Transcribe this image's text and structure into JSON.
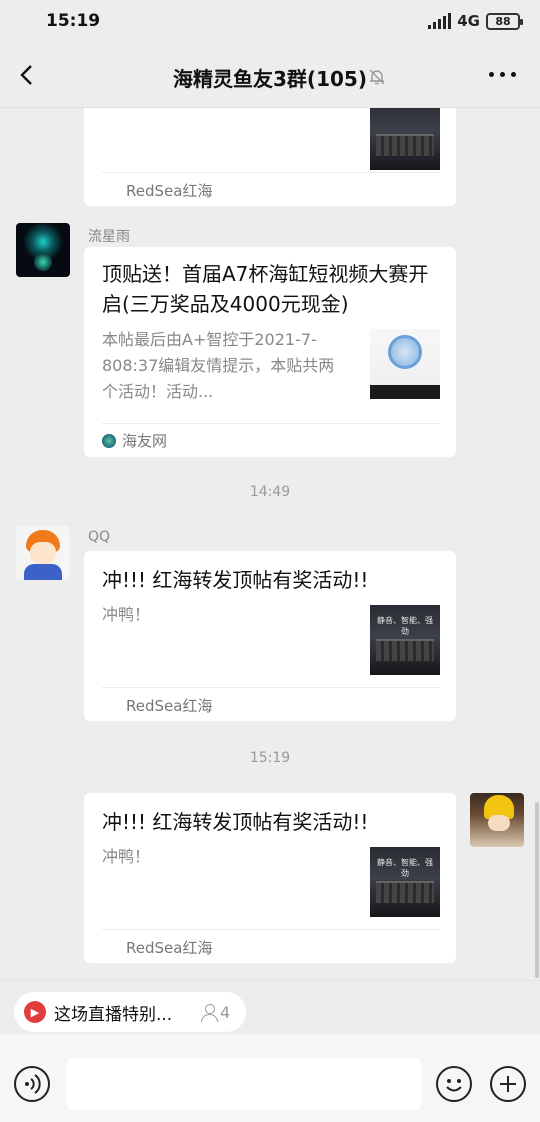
{
  "status": {
    "time": "15:19",
    "network": "4G",
    "battery": "88"
  },
  "header": {
    "title": "海精灵鱼友3群(105)"
  },
  "messages": [
    {
      "type": "card",
      "source": "RedSea红海"
    },
    {
      "type": "card",
      "sender": "流星雨",
      "title": "顶贴送！首届A7杯海缸短视频大赛开启(三万奖品及4000元现金)",
      "desc": "本帖最后由A+智控于2021-7-808:37编辑友情提示，本贴共两个活动！活动...",
      "source": "海友网"
    },
    {
      "type": "time",
      "text": "14:49"
    },
    {
      "type": "card",
      "sender": "QQ",
      "title": "冲!!! 红海转发顶帖有奖活动!!",
      "desc": "冲鸭！",
      "thumb_text": "静音、智能、强劲",
      "source": "RedSea红海"
    },
    {
      "type": "time",
      "text": "15:19"
    },
    {
      "type": "card",
      "sender": "me",
      "title": "冲!!! 红海转发顶帖有奖活动!!",
      "desc": "冲鸭！",
      "thumb_text": "静音、智能、强劲",
      "source": "RedSea红海"
    }
  ],
  "live": {
    "text": "这场直播特别...",
    "viewers": "4"
  },
  "input": {
    "placeholder": ""
  }
}
